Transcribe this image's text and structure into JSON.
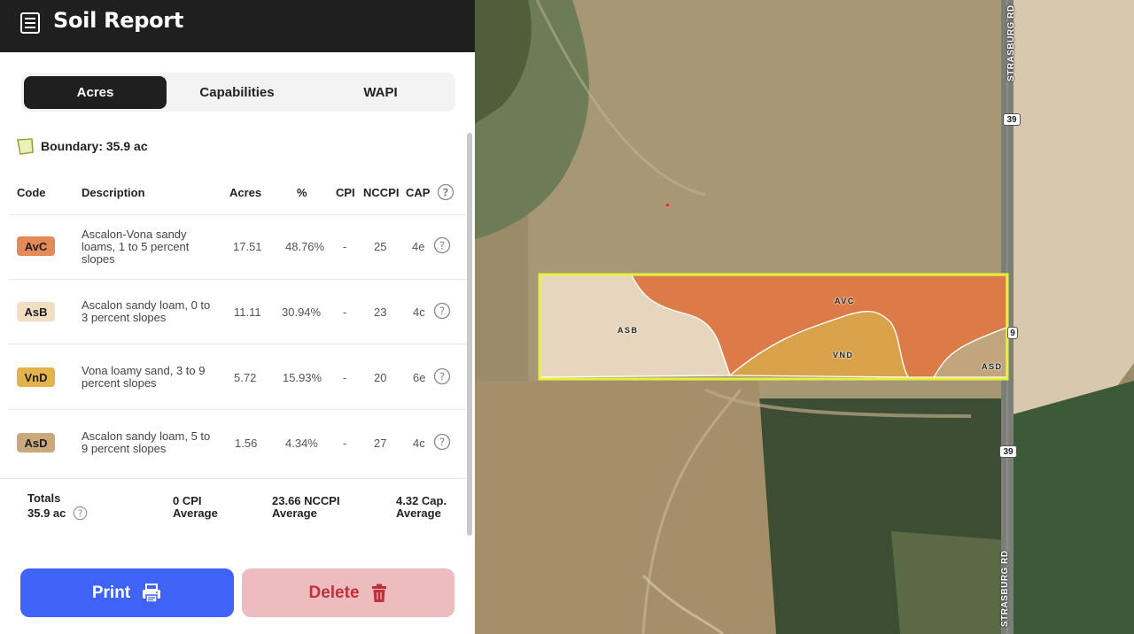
{
  "header": {
    "title": "Soil Report",
    "icon": "report-icon"
  },
  "tabs": [
    {
      "label": "Acres",
      "active": true
    },
    {
      "label": "Capabilities",
      "active": false
    },
    {
      "label": "WAPI",
      "active": false
    }
  ],
  "boundary": {
    "text": "Boundary: 35.9 ac"
  },
  "table": {
    "headers": {
      "code": "Code",
      "description": "Description",
      "acres": "Acres",
      "percent": "%",
      "cpi": "CPI",
      "nccpi": "NCCPI",
      "cap": "CAP"
    },
    "rows": [
      {
        "code": "AvC",
        "color": "#e48a58",
        "description": "Ascalon-Vona sandy loams, 1 to 5 percent slopes",
        "acres": "17.51",
        "percent": "48.76%",
        "cpi": "-",
        "nccpi": "25",
        "cap": "4e"
      },
      {
        "code": "AsB",
        "color": "#f1dfc3",
        "description": "Ascalon sandy loam, 0 to 3 percent slopes",
        "acres": "11.11",
        "percent": "30.94%",
        "cpi": "-",
        "nccpi": "23",
        "cap": "4c"
      },
      {
        "code": "VnD",
        "color": "#e4b34c",
        "description": "Vona loamy sand, 3 to 9 percent slopes",
        "acres": "5.72",
        "percent": "15.93%",
        "cpi": "-",
        "nccpi": "20",
        "cap": "6e"
      },
      {
        "code": "AsD",
        "color": "#c9a87c",
        "description": "Ascalon sandy loam, 5 to 9 percent slopes",
        "acres": "1.56",
        "percent": "4.34%",
        "cpi": "-",
        "nccpi": "27",
        "cap": "4c"
      }
    ]
  },
  "totals": {
    "label": "Totals",
    "acres": "35.9 ac",
    "cpi_value": "0 CPI",
    "cpi_sub": "Average",
    "nccpi_value": "23.66 NCCPI",
    "nccpi_sub": "Average",
    "cap_value": "4.32 Cap.",
    "cap_sub": "Average"
  },
  "buttons": {
    "print": "Print",
    "delete": "Delete"
  },
  "map": {
    "road_name": "STRASBURG RD",
    "shields": [
      "39",
      "39",
      "9"
    ],
    "soil_labels": [
      "AVC",
      "ASB",
      "VND",
      "ASD"
    ],
    "boundary_color": "#e6f03c"
  }
}
